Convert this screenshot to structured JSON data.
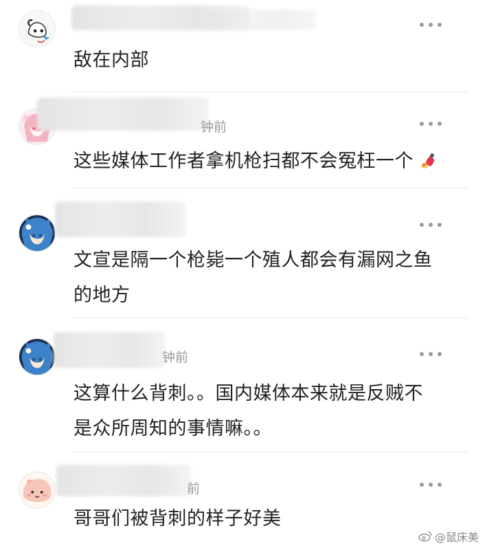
{
  "comments": [
    {
      "avatar": "anime-avatar-white",
      "time": "",
      "text_lines": [
        "敌在内部"
      ],
      "has_emoji": false
    },
    {
      "avatar": "anime-avatar-pink",
      "time": "钟前",
      "text_lines": [
        "这些媒体工作者拿机枪扫都不会冤枉一个"
      ],
      "has_emoji": true
    },
    {
      "avatar": "anime-avatar-blue",
      "time": "",
      "text_lines": [
        "文宣是隔一个枪毙一个殖人都会有漏网之鱼",
        "的地方"
      ],
      "has_emoji": false
    },
    {
      "avatar": "anime-avatar-blue",
      "time": "钟前",
      "text_lines": [
        "这算什么背刺。。国内媒体本来就是反贼不",
        "是众所周知的事情嘛。。"
      ],
      "has_emoji": false
    },
    {
      "avatar": "anime-avatar-peach",
      "time": "前",
      "text_lines": [
        "哥哥们被背刺的样子好美"
      ],
      "has_emoji": false
    }
  ],
  "emoji": "nail-polish-emoji",
  "watermark": {
    "text": "@鼠床美",
    "icon": "weibo-icon"
  },
  "colors": {
    "text": "#222222",
    "meta": "#9a9a9a",
    "divider": "#e8e8e8"
  }
}
